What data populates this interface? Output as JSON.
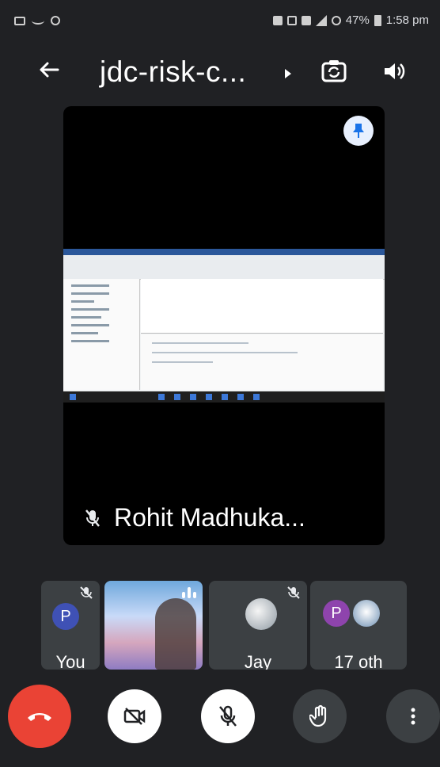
{
  "status_bar": {
    "battery_percent": "47%",
    "time": "1:58 pm"
  },
  "toolbar": {
    "meeting_title": "jdc-risk-c..."
  },
  "main_tile": {
    "participant_name": "Rohit Madhuka..."
  },
  "participants": [
    {
      "label": "You",
      "avatar_letter": "P",
      "muted": true
    },
    {
      "label": "",
      "video": true,
      "speaking": true
    },
    {
      "label": "Jay",
      "muted": true
    },
    {
      "label": "17 oth",
      "avatar_letter": "P"
    }
  ],
  "colors": {
    "background": "#202124",
    "end_call": "#ea4335",
    "avatar_blue": "#3f51b5",
    "avatar_purple": "#8e44ad",
    "tile": "#3c4043"
  }
}
